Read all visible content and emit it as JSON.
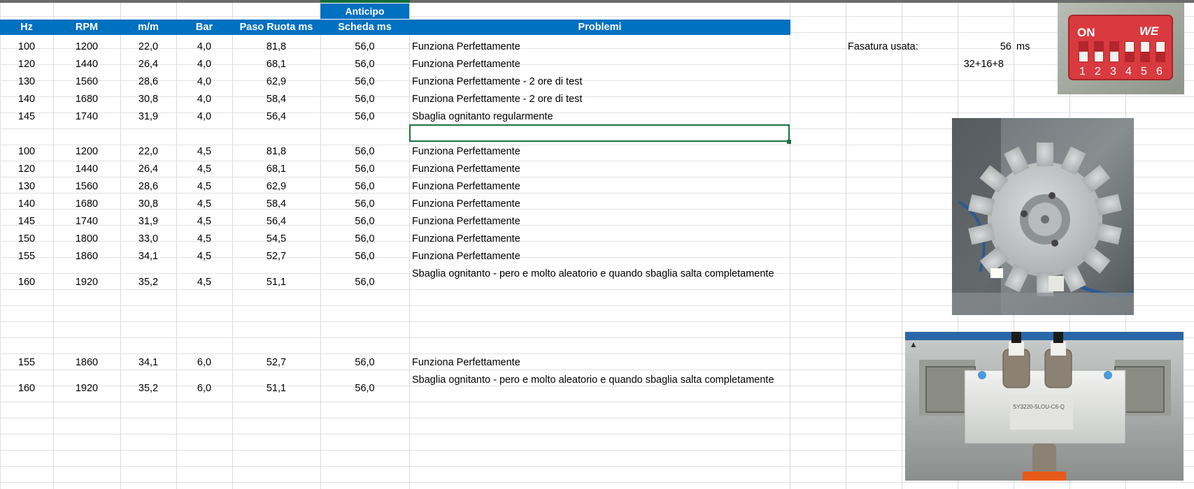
{
  "header": {
    "top_label": "Anticipo",
    "columns": [
      "Hz",
      "RPM",
      "m/m",
      "Bar",
      "Paso Ruota ms",
      "Scheda ms",
      "Problemi"
    ]
  },
  "group1": [
    [
      "100",
      "1200",
      "22,0",
      "4,0",
      "81,8",
      "56,0",
      "Funziona Perfettamente"
    ],
    [
      "120",
      "1440",
      "26,4",
      "4,0",
      "68,1",
      "56,0",
      "Funziona Perfettamente"
    ],
    [
      "130",
      "1560",
      "28,6",
      "4,0",
      "62,9",
      "56,0",
      "Funziona Perfettamente - 2 ore di test"
    ],
    [
      "140",
      "1680",
      "30,8",
      "4,0",
      "58,4",
      "56,0",
      "Funziona Perfettamente - 2 ore di test"
    ],
    [
      "145",
      "1740",
      "31,9",
      "4,0",
      "56,4",
      "56,0",
      "Sbaglia ognitanto regularmente"
    ]
  ],
  "group2": [
    [
      "100",
      "1200",
      "22,0",
      "4,5",
      "81,8",
      "56,0",
      "Funziona Perfettamente"
    ],
    [
      "120",
      "1440",
      "26,4",
      "4,5",
      "68,1",
      "56,0",
      "Funziona Perfettamente"
    ],
    [
      "130",
      "1560",
      "28,6",
      "4,5",
      "62,9",
      "56,0",
      "Funziona Perfettamente"
    ],
    [
      "140",
      "1680",
      "30,8",
      "4,5",
      "58,4",
      "56,0",
      "Funziona Perfettamente"
    ],
    [
      "145",
      "1740",
      "31,9",
      "4,5",
      "56,4",
      "56,0",
      "Funziona Perfettamente"
    ],
    [
      "150",
      "1800",
      "33,0",
      "4,5",
      "54,5",
      "56,0",
      "Funziona Perfettamente"
    ],
    [
      "155",
      "1860",
      "34,1",
      "4,5",
      "52,7",
      "56,0",
      "Funziona Perfettamente"
    ],
    [
      "160",
      "1920",
      "35,2",
      "4,5",
      "51,1",
      "56,0",
      "Sbaglia ognitanto - pero e molto aleatorio e quando sbaglia salta completamente"
    ]
  ],
  "group3": [
    [
      "155",
      "1860",
      "34,1",
      "6,0",
      "52,7",
      "56,0",
      "Funziona Perfettamente"
    ],
    [
      "160",
      "1920",
      "35,2",
      "6,0",
      "51,1",
      "56,0",
      "Sbaglia ognitanto - pero e molto aleatorio e quando sbaglia salta completamente"
    ]
  ],
  "side": {
    "fasatura_label": "Fasatura usata:",
    "fasatura_value": "56",
    "fasatura_unit": "ms",
    "fasatura_formula": "32+16+8"
  },
  "dip_switch": {
    "on_label": "ON",
    "brand": "WE",
    "numbers": [
      "1",
      "2",
      "3",
      "4",
      "5",
      "6"
    ],
    "color": "#d93a3f"
  },
  "valve_label": "SY3220-5LOU-C6-Q"
}
